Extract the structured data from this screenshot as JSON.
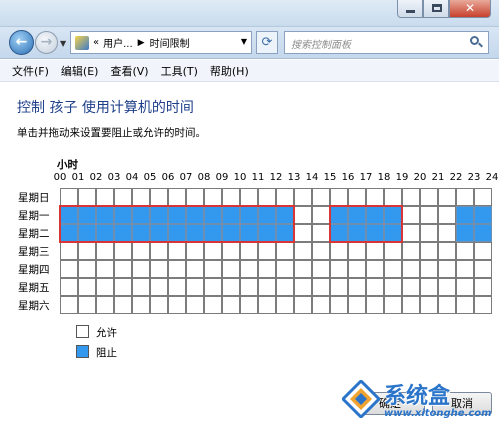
{
  "window": {
    "close_glyph": "✕"
  },
  "nav": {
    "breadcrumb": [
      "用户...",
      "时间限制"
    ],
    "breadcrumb_prefix": "«",
    "search_placeholder": "搜索控制面板"
  },
  "menu": [
    "文件(F)",
    "编辑(E)",
    "查看(V)",
    "工具(T)",
    "帮助(H)"
  ],
  "content": {
    "title": "控制  孩子  使用计算机的时间",
    "instruction": "单击并拖动来设置要阻止或允许的时间。",
    "hours_label": "小时",
    "hours": [
      "00",
      "01",
      "02",
      "03",
      "04",
      "05",
      "06",
      "07",
      "08",
      "09",
      "10",
      "11",
      "12",
      "13",
      "14",
      "15",
      "16",
      "17",
      "18",
      "19",
      "20",
      "21",
      "22",
      "23",
      "24"
    ],
    "days": [
      "星期日",
      "星期一",
      "星期二",
      "星期三",
      "星期四",
      "星期五",
      "星期六"
    ],
    "blocked_slots": [
      {
        "day": 1,
        "hours": [
          0,
          1,
          2,
          3,
          4,
          5,
          6,
          7,
          8,
          9,
          10,
          11,
          12,
          15,
          16,
          17,
          18,
          22,
          23
        ]
      },
      {
        "day": 2,
        "hours": [
          0,
          1,
          2,
          3,
          4,
          5,
          6,
          7,
          8,
          9,
          10,
          11,
          12,
          15,
          16,
          17,
          18,
          22,
          23
        ]
      }
    ],
    "highlighted_ranges": [
      {
        "days": [
          1,
          2
        ],
        "from": 0,
        "to": 13
      },
      {
        "days": [
          1,
          2
        ],
        "from": 15,
        "to": 19
      }
    ],
    "colors": {
      "allowed": "#ffffff",
      "blocked": "#3399ef",
      "highlight": "#d93535"
    }
  },
  "legend": {
    "allow": "允许",
    "block": "阻止"
  },
  "buttons": {
    "ok": "确定",
    "cancel": "取消"
  },
  "watermark": {
    "brand": "系统盒",
    "url": "www.xitonghe.com"
  }
}
